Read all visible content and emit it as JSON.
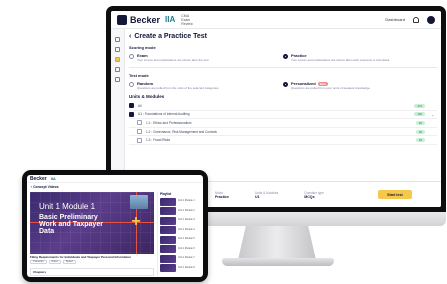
{
  "desktop": {
    "brand": "Becker",
    "partner": "IIA",
    "badge": "CMA Exam Review",
    "top_link": "Dashboard",
    "page_title": "Create a Practice Test",
    "scoring_mode": {
      "label": "Scoring mode",
      "options": [
        {
          "title": "Exam",
          "desc": "Your scores and explanations are shown after the test."
        },
        {
          "title": "Practice",
          "desc": "Your scores and explanations are shown after each response is submitted."
        }
      ],
      "selected_index": 1
    },
    "test_mode": {
      "label": "Test mode",
      "options": [
        {
          "title": "Random",
          "desc": "Questions are pulled from the units of the selected categories."
        },
        {
          "title": "Personalized",
          "badge": "Beta",
          "desc": "Questions are pulled from your units of weakest knowledge."
        }
      ],
      "selected_index": 1
    },
    "units": {
      "title": "Units & Modules",
      "rows": [
        {
          "label": "All",
          "checked": true,
          "child": false,
          "count": "472"
        },
        {
          "label": "U1 : Foundations of Internal Auditing",
          "checked": true,
          "child": false,
          "count": "120"
        },
        {
          "label": "1.1 : Ethics and Professionalism",
          "checked": false,
          "child": true,
          "count": "20"
        },
        {
          "label": "1.2 : Governance, Risk Management and Controls",
          "checked": false,
          "child": true,
          "count": "30"
        },
        {
          "label": "1.3 : Fraud Risks",
          "checked": false,
          "child": true,
          "count": "18"
        }
      ]
    },
    "summary": {
      "mode_label": "Mode",
      "mode_value": "Practice",
      "units_label": "Units & Modules",
      "units_value": "U1",
      "qtype_label": "Question type",
      "qtype_value": "MCQs",
      "start_label": "Start test"
    }
  },
  "tablet": {
    "brand": "Becker",
    "partner": "IIA",
    "breadcrumb": "Concept Videos",
    "video": {
      "title_line1": "Unit 1 Module 1",
      "title_line2": "Basic Preliminary Work and Taxpayer Data"
    },
    "caption": "Filing Requirements for Individuals and Taxpayer Personal Information",
    "controls": [
      "Transcript",
      "Notes",
      "Speed"
    ],
    "chapters_label": "Chapters",
    "playlist": {
      "head": "Playlist",
      "items": [
        "Unit 1 Module 1",
        "Unit 1 Module 2",
        "Unit 1 Module 3",
        "Unit 1 Module 4",
        "Unit 1 Module 5",
        "Unit 1 Module 6",
        "Unit 1 Module 7",
        "Unit 1 Module 8"
      ]
    }
  },
  "colors": {
    "navy": "#14163a",
    "accent_yellow": "#f5c84b",
    "count_green": "#c9efd6",
    "video_purple": "#4a3380"
  }
}
